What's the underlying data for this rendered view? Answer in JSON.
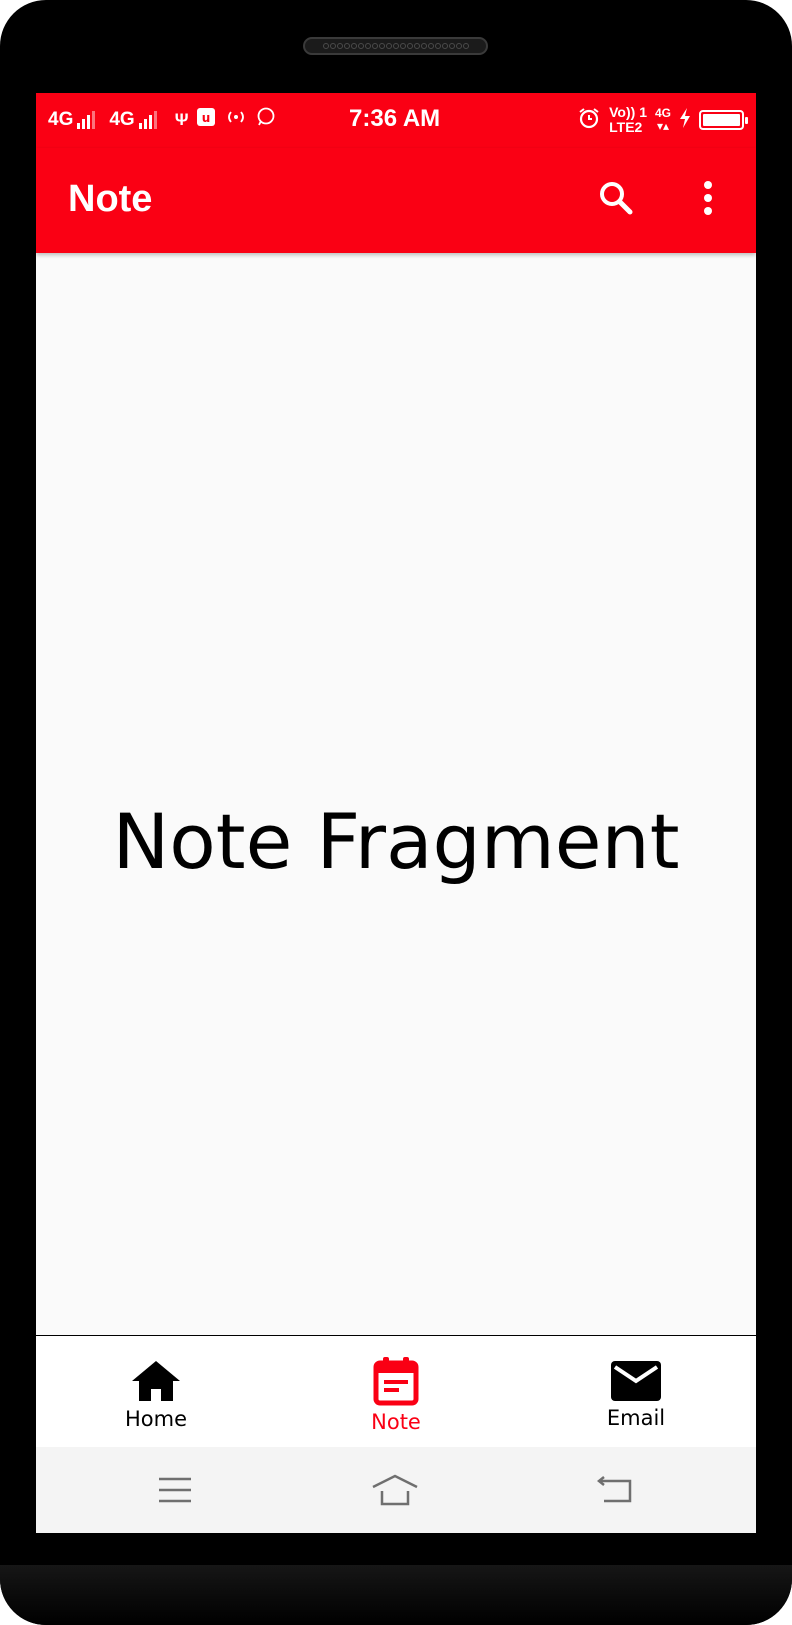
{
  "status_bar": {
    "network1": "4G",
    "network2": "4G",
    "time": "7:36 AM",
    "volte_top": "Vo)) 1",
    "volte_bottom": "LTE2",
    "network3": "4G"
  },
  "app_bar": {
    "title": "Note",
    "search_icon": "search-icon",
    "more_icon": "more-vert-icon"
  },
  "content": {
    "text": "Note Fragment"
  },
  "bottom_nav": {
    "items": [
      {
        "label": "Home",
        "icon": "home-icon",
        "active": false
      },
      {
        "label": "Note",
        "icon": "note-icon",
        "active": true
      },
      {
        "label": "Email",
        "icon": "email-icon",
        "active": false
      }
    ]
  },
  "colors": {
    "primary": "#fa0014",
    "background": "#fafafa",
    "nav_inactive": "#000000",
    "nav_active": "#fa0014"
  }
}
